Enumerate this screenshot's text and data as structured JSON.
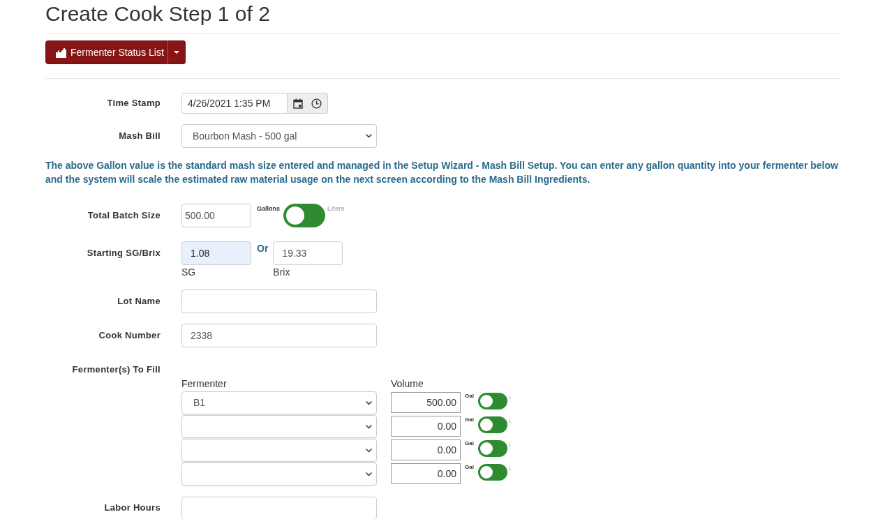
{
  "page_title": "Create Cook Step 1 of 2",
  "toolbar": {
    "split_button": {
      "label": "Fermenter Status List"
    }
  },
  "form": {
    "time_stamp": {
      "label": "Time Stamp",
      "value": "4/26/2021 1:35 PM"
    },
    "mash_bill": {
      "label": "Mash Bill",
      "value": "Bourbon Mash - 500 gal"
    },
    "info_text": "The above Gallon value is the standard mash size entered and managed in the Setup Wizard - Mash Bill Setup. You can enter any gallon quantity into your fermenter below and the system will scale the estimated raw material usage on the next screen according to the Mash Bill Ingredients.",
    "total_batch_size": {
      "label": "Total Batch Size",
      "value": "500.00",
      "unit_switch": {
        "left_label": "Gallons",
        "right_label": "Liters",
        "checked": false
      }
    },
    "starting_sg_brix": {
      "label": "Starting SG/Brix",
      "sg": {
        "value": "1.08",
        "caption": "SG",
        "autofilled": true
      },
      "separator": "Or",
      "brix": {
        "value": "19.33",
        "caption": "Brix",
        "autofilled": false
      }
    },
    "lot_name": {
      "label": "Lot Name"
    },
    "cook_number": {
      "label": "Cook Number",
      "value": "2338"
    },
    "fermenters": {
      "label": "Fermenter(s) To Fill",
      "columns": [
        "Fermenter",
        "Volume"
      ],
      "rows": [
        {
          "fermenter": "B1",
          "volume": "500.00",
          "unit_left": "Gal",
          "unit_right": "L",
          "checked": false
        },
        {
          "volume": "0.00",
          "unit_left": "Gal",
          "unit_right": "L",
          "checked": false
        },
        {
          "volume": "0.00",
          "unit_left": "Gal",
          "unit_right": "L",
          "checked": false
        },
        {
          "volume": "0.00",
          "unit_left": "Gal",
          "unit_right": "L",
          "checked": false
        }
      ]
    },
    "labor_hours": {
      "label": "Labor Hours"
    }
  }
}
